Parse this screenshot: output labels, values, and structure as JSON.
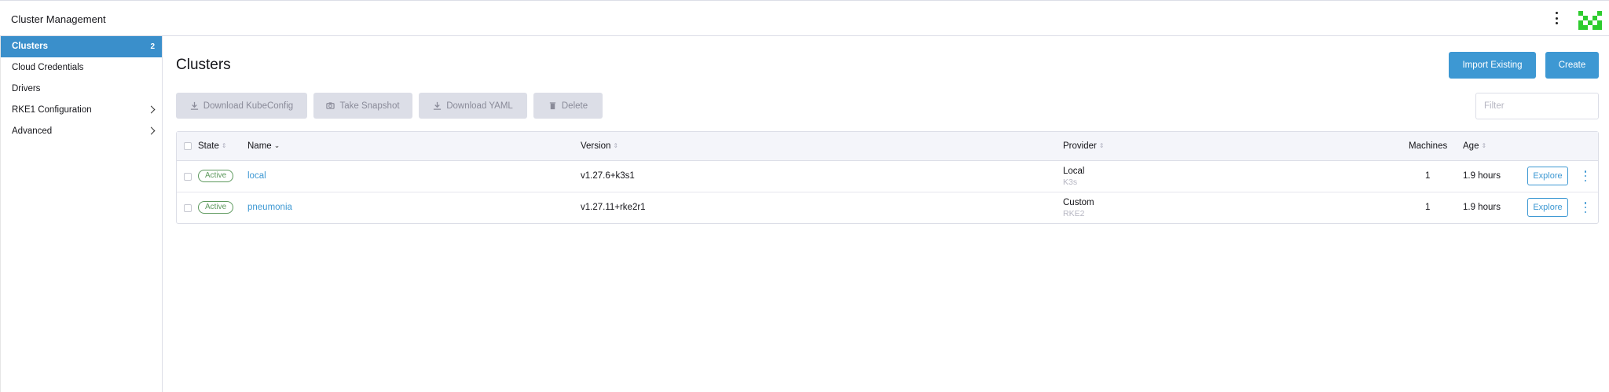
{
  "header": {
    "title": "Cluster Management",
    "menu_icon": "vertical-dots-icon",
    "avatar_icon": "user-avatar-icon",
    "avatar_color": "#2ecc2e"
  },
  "sidebar": {
    "items": [
      {
        "label": "Clusters",
        "count": "2",
        "active": true
      },
      {
        "label": "Cloud Credentials"
      },
      {
        "label": "Drivers"
      },
      {
        "label": "RKE1 Configuration",
        "expandable": true
      },
      {
        "label": "Advanced",
        "expandable": true
      }
    ],
    "accent": "#3a8fcb"
  },
  "main": {
    "title": "Clusters",
    "actions": {
      "import_label": "Import Existing",
      "create_label": "Create"
    },
    "bulk": {
      "kubeconfig_label": "Download KubeConfig",
      "snapshot_label": "Take Snapshot",
      "yaml_label": "Download YAML",
      "delete_label": "Delete"
    },
    "filter": {
      "placeholder": "Filter",
      "value": ""
    }
  },
  "table": {
    "columns": {
      "state": "State",
      "name": "Name",
      "version": "Version",
      "provider": "Provider",
      "machines": "Machines",
      "age": "Age"
    },
    "rows": [
      {
        "state": "Active",
        "name": "local",
        "version": "v1.27.6+k3s1",
        "provider": "Local",
        "provider_sub": "K3s",
        "machines": "1",
        "age": "1.9 hours",
        "action": "Explore"
      },
      {
        "state": "Active",
        "name": "pneumonia",
        "version": "v1.27.11+rke2r1",
        "provider": "Custom",
        "provider_sub": "RKE2",
        "machines": "1",
        "age": "1.9 hours",
        "action": "Explore"
      }
    ]
  },
  "colors": {
    "primary": "#3d98d3",
    "active_state": "#5d995d",
    "disabled_button": "#dcdee7"
  }
}
